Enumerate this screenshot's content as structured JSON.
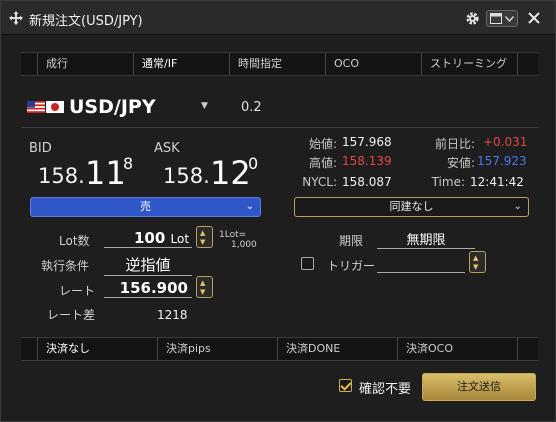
{
  "window": {
    "title": "新規注文(USD/JPY)"
  },
  "order_tabs": [
    "成行",
    "通常/IF",
    "時間指定",
    "OCO",
    "ストリーミング"
  ],
  "pair": {
    "name": "USD/JPY",
    "spread": "0.2"
  },
  "bid": {
    "label": "BID",
    "prefix": "158.",
    "big": "11",
    "sup": "8"
  },
  "ask": {
    "label": "ASK",
    "prefix": "158.",
    "big": "12",
    "sup": "0"
  },
  "quote": {
    "open_label": "始値:",
    "open": "157.968",
    "high_label": "高値:",
    "high": "158.139",
    "nycl_label": "NYCL:",
    "nycl": "158.087",
    "change_label": "前日比:",
    "change": "+0.031",
    "low_label": "安値:",
    "low": "157.923",
    "time_label": "Time:",
    "time": "12:41:42"
  },
  "side_select": {
    "value": "売"
  },
  "link_select": {
    "value": "同建なし"
  },
  "form": {
    "lot_label": "Lot数",
    "lot_value": "100",
    "lot_unit": "Lot",
    "lot_note_1": "1Lot=",
    "lot_note_2": "1,000",
    "exec_label": "執行条件",
    "exec_value": "逆指値",
    "rate_label": "レート",
    "rate_value": "156.900",
    "rate_diff_label": "レート差",
    "rate_diff_value": "1218",
    "term_label": "期限",
    "term_value": "無期限",
    "trigger_label": "トリガー"
  },
  "settle_tabs": [
    "決済なし",
    "決済pips",
    "決済DONE",
    "決済OCO"
  ],
  "footer": {
    "confirm_label": "確認不要",
    "submit_label": "注文送信"
  },
  "colors": {
    "up": "#e04848",
    "down": "#4a78e8",
    "high": "#e04848",
    "low": "#4a78e8",
    "accent": "#d0b050",
    "sell": "#2f57c8"
  }
}
